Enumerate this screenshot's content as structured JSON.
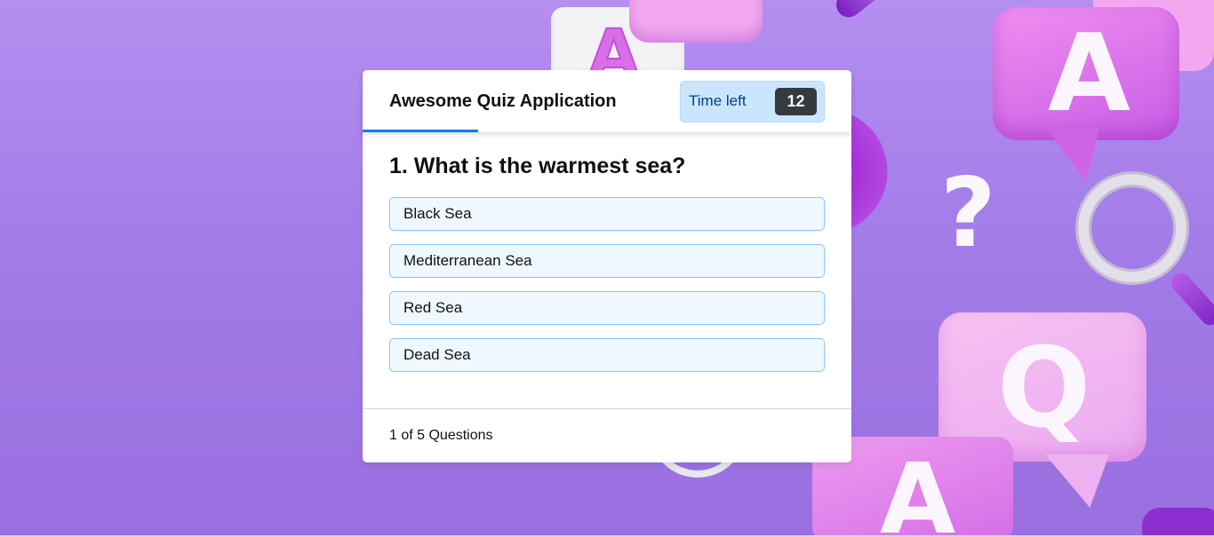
{
  "background": {
    "decorations": [
      "letter-a-tile",
      "speech-bubble",
      "pen",
      "letter-a-bubble",
      "gear",
      "question-mark",
      "magnifier",
      "letter-q-bubble",
      "letter-a-tile-bottom"
    ],
    "glyphs": {
      "a": "A",
      "question": "?",
      "q": "Q"
    }
  },
  "quiz": {
    "title": "Awesome Quiz Application",
    "timer": {
      "label": "Time left",
      "seconds": "12"
    },
    "question": "1. What is the warmest sea?",
    "options": [
      "Black Sea",
      "Mediterranean Sea",
      "Red Sea",
      "Dead Sea"
    ],
    "footer": {
      "progress": "1 of 5 Questions"
    }
  },
  "colors": {
    "accent": "#007bff",
    "timer_bg": "#cce5ff",
    "option_bg": "#f0f8ff",
    "option_border": "#84c5fe"
  }
}
